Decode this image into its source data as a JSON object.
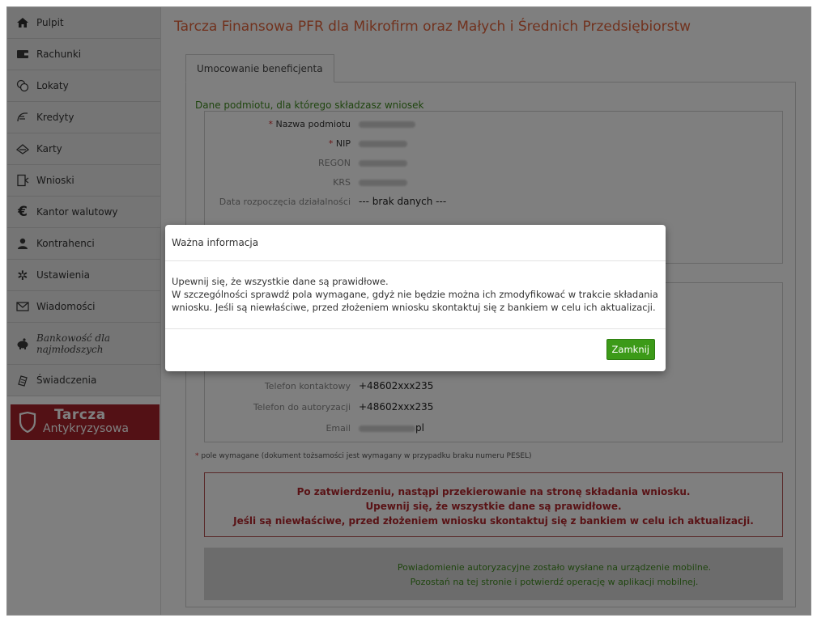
{
  "sidebar": {
    "items": [
      {
        "label": "Pulpit",
        "icon": "home-icon"
      },
      {
        "label": "Rachunki",
        "icon": "wallet-icon"
      },
      {
        "label": "Lokaty",
        "icon": "coins-icon"
      },
      {
        "label": "Kredyty",
        "icon": "credit-icon"
      },
      {
        "label": "Karty",
        "icon": "card-icon"
      },
      {
        "label": "Wnioski",
        "icon": "document-icon"
      },
      {
        "label": "Kantor walutowy",
        "icon": "euro-icon"
      },
      {
        "label": "Kontrahenci",
        "icon": "contacts-icon"
      },
      {
        "label": "Ustawienia",
        "icon": "gear-icon"
      },
      {
        "label": "Wiadomości",
        "icon": "envelope-icon"
      },
      {
        "label": "Bankowość dla najmłodszych",
        "icon": "piggy-bank-icon"
      },
      {
        "label": "Świadczenia",
        "icon": "benefits-icon"
      }
    ],
    "banner": {
      "line1": "Tarcza",
      "line2": "Antykryzysowa",
      "color": "#a6232b"
    }
  },
  "main": {
    "title": "Tarcza Finansowa PFR dla Mikrofirm oraz Małych i Średnich Przedsiębiorstw",
    "tab_label": "Umocowanie beneficjenta",
    "section_label": "Dane podmiotu, dla którego składzasz wniosek",
    "entity_fields": [
      {
        "label": "Nazwa podmiotu",
        "required": "*"
      },
      {
        "label": "NIP",
        "required": "*"
      },
      {
        "label": "REGON",
        "required": ""
      },
      {
        "label": "KRS",
        "required": ""
      },
      {
        "label": "Data rozpoczęcia działalności",
        "value": "--- brak danych ---"
      }
    ],
    "contact_fields": [
      {
        "label": "Telefon kontaktowy",
        "value": "+48602xxx235"
      },
      {
        "label": "Telefon do autoryzacji",
        "value": "+48602xxx235"
      },
      {
        "label": "Email",
        "value_suffix": "pl"
      }
    ],
    "footnote_star": "*",
    "footnote": " pole wymagane (dokument tożsamości jest wymagany w przypadku braku numeru PESEL)",
    "warning": {
      "line1": "Po zatwierdzeniu, nastąpi przekierowanie na stronę składania wniosku.",
      "line2": "Upewnij się, że wszystkie dane są prawidłowe.",
      "line3": "Jeśli są niewłaściwe, przed złożeniem wniosku skontaktuj się z bankiem w celu ich aktualizacji."
    },
    "notice": {
      "line1": "Powiadomienie autoryzacyjne zostało wysłane na urządzenie mobilne.",
      "line2": "Pozostań na tej stronie i potwierdź operację w aplikacji mobilnej."
    }
  },
  "modal": {
    "title": "Ważna informacja",
    "line1": "Upewnij się, że wszystkie dane są prawidłowe.",
    "line2": "W szczególności sprawdź pola wymagane, gdyż nie będzie można ich zmodyfikować w trakcie składania",
    "line3": "wniosku. Jeśli są niewłaściwe, przed złożeniem wniosku skontaktuj się z bankiem w celu ich aktualizacji.",
    "close_label": "Zamknij"
  },
  "colors": {
    "accent_orange": "#e2643c",
    "green": "#3f8b1e",
    "button_green": "#3c9a18",
    "warning_red": "#b3262d"
  }
}
